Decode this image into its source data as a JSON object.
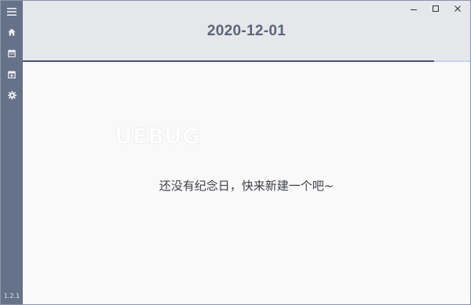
{
  "app": {
    "version": "1.2.1"
  },
  "sidebar": {
    "items": [
      {
        "icon": "menu-icon",
        "label": "menu"
      },
      {
        "icon": "home-icon",
        "label": "home"
      },
      {
        "icon": "calendar-icon",
        "label": "calendar"
      },
      {
        "icon": "calendar-add-icon",
        "label": "add event"
      },
      {
        "icon": "gear-icon",
        "label": "settings"
      }
    ]
  },
  "header": {
    "title": "2020-12-01"
  },
  "window_controls": {
    "minimize": "–",
    "maximize": "□",
    "close": "✕"
  },
  "progress": {
    "value": 0.92
  },
  "main": {
    "empty_message": "还没有纪念日，快来新建一个吧~",
    "watermark": "UEBUG"
  },
  "colors": {
    "sidebar": "#66718a",
    "header": "#e6e7eb",
    "title": "#5d6577",
    "progress": "#4c5468",
    "background": "#f9f9f9"
  }
}
